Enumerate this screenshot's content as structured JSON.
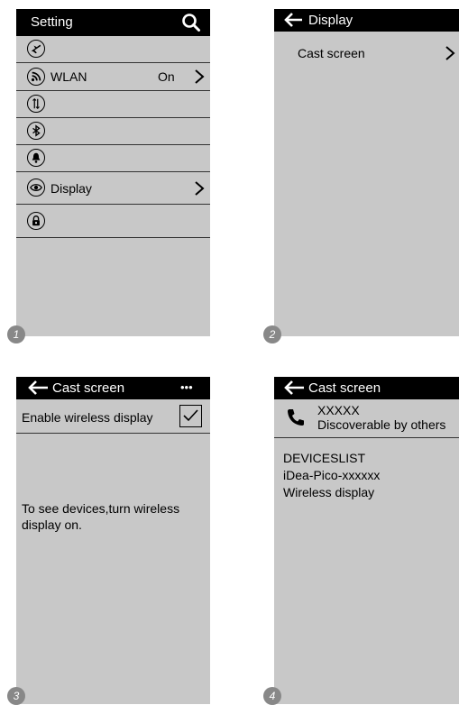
{
  "screen1": {
    "title": "Setting",
    "wlan_label": "WLAN",
    "wlan_value": "On",
    "display_label": "Display",
    "step": "1"
  },
  "screen2": {
    "title": "Display",
    "cast_label": "Cast screen",
    "step": "2"
  },
  "screen3": {
    "title": "Cast screen",
    "more": "•••",
    "enable_label": "Enable wireless display",
    "enabled": true,
    "hint_line1": "To see devices,turn wireless",
    "hint_line2": "display on.",
    "step": "3"
  },
  "screen4": {
    "title": "Cast screen",
    "device_name": "XXXXX",
    "device_status": "Discoverable by others",
    "list_header": "DEVICESLIST",
    "list_items": [
      "iDea-Pico-xxxxxx",
      "Wireless display"
    ],
    "step": "4"
  },
  "icons": {
    "search": "search-icon",
    "airplane": "airplane-icon",
    "wifi": "wifi-icon",
    "data": "mobile-data-icon",
    "bluetooth": "bluetooth-icon",
    "bell": "bell-icon",
    "eye": "eye-icon",
    "lock": "lock-icon",
    "back": "back-arrow-icon",
    "phone": "phone-icon",
    "check": "checkbox-checked-icon"
  }
}
